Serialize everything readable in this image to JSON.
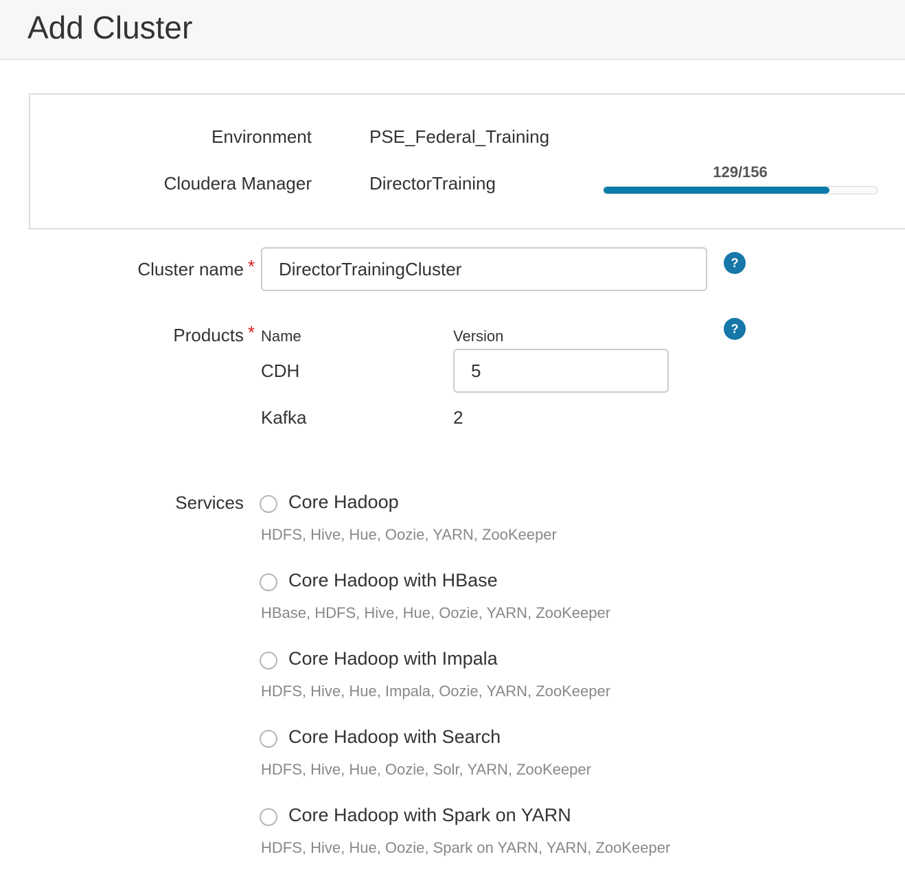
{
  "header": {
    "title": "Add Cluster"
  },
  "summary": {
    "environment_label": "Environment",
    "environment_value": "PSE_Federal_Training",
    "manager_label": "Cloudera Manager",
    "manager_value": "DirectorTraining",
    "progress_text": "129/156",
    "progress_fraction": 0.827
  },
  "form": {
    "cluster_name_label": "Cluster name",
    "cluster_name_value": "DirectorTrainingCluster",
    "required_mark": "*",
    "help_glyph": "?",
    "products_label": "Products",
    "products_col_name": "Name",
    "products_col_version": "Version",
    "products": [
      {
        "name": "CDH",
        "version": "5"
      },
      {
        "name": "Kafka",
        "version": "2"
      }
    ],
    "services_label": "Services",
    "services": [
      {
        "name": "Core Hadoop",
        "desc": "HDFS, Hive, Hue, Oozie, YARN, ZooKeeper"
      },
      {
        "name": "Core Hadoop with HBase",
        "desc": "HBase, HDFS, Hive, Hue, Oozie, YARN, ZooKeeper"
      },
      {
        "name": "Core Hadoop with Impala",
        "desc": "HDFS, Hive, Hue, Impala, Oozie, YARN, ZooKeeper"
      },
      {
        "name": "Core Hadoop with Search",
        "desc": "HDFS, Hive, Hue, Oozie, Solr, YARN, ZooKeeper"
      },
      {
        "name": "Core Hadoop with Spark on YARN",
        "desc": "HDFS, Hive, Hue, Oozie, Spark on YARN, YARN, ZooKeeper"
      }
    ]
  },
  "colors": {
    "accent": "#0a7bab",
    "required": "#d81d1d",
    "help": "#1677a8"
  },
  "icons": {
    "help": "help-icon",
    "radio": "radio-button"
  }
}
